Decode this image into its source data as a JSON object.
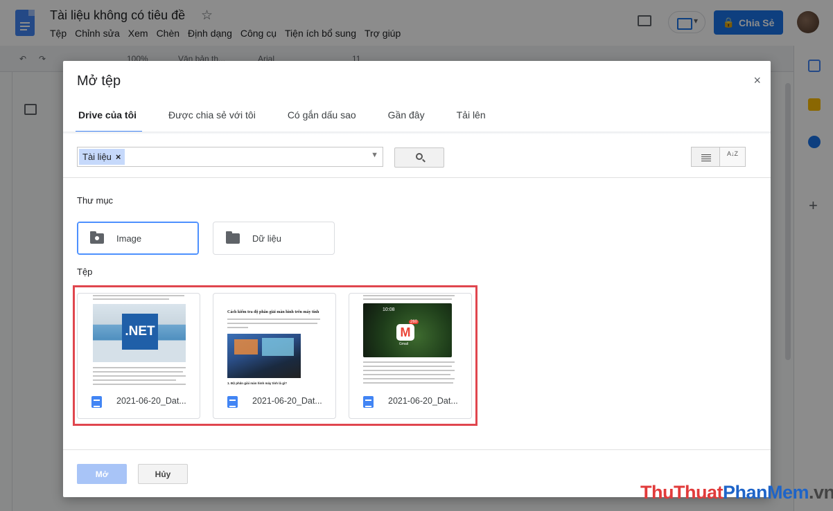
{
  "app": {
    "doc_title": "Tài liệu không có tiêu đề",
    "menu": [
      "Tệp",
      "Chỉnh sửa",
      "Xem",
      "Chèn",
      "Định dạng",
      "Công cụ",
      "Tiện ích bổ sung",
      "Trợ giúp"
    ],
    "share_label": "Chia Sẻ",
    "toolbar": {
      "zoom": "100%",
      "style": "Văn bản th...",
      "font": "Arial",
      "font_size": "11"
    }
  },
  "dialog": {
    "title": "Mở tệp",
    "close_glyph": "×",
    "tabs": [
      {
        "label": "Drive của tôi",
        "active": true
      },
      {
        "label": "Được chia sẻ với tôi",
        "active": false
      },
      {
        "label": "Có gắn dấu sao",
        "active": false
      },
      {
        "label": "Gần đây",
        "active": false
      },
      {
        "label": "Tải lên",
        "active": false
      }
    ],
    "search": {
      "chip_label": "Tài liệu",
      "chip_remove": "×",
      "sort_icon_text": "A↓Z"
    },
    "folders_heading": "Thư mục",
    "folders": [
      {
        "name": "Image",
        "icon": "shared-folder-icon",
        "selected": true
      },
      {
        "name": "Dữ liệu",
        "icon": "folder-icon",
        "selected": false
      }
    ],
    "files_heading": "Tệp",
    "files": [
      {
        "name": "2021-06-20_Dat...",
        "thumb_text": ".NET"
      },
      {
        "name": "2021-06-20_Dat...",
        "thumb_title": "Cách kiểm tra độ phân giải màn hình trên máy tính",
        "thumb_subhead": "1. Độ phân giải màn hình máy tính là gì?"
      },
      {
        "name": "2021-06-20_Dat...",
        "thumb_time": "10:08",
        "thumb_badge": "260",
        "thumb_app": "Gmail"
      }
    ],
    "buttons": {
      "open": "Mở",
      "cancel": "Hủy"
    }
  },
  "watermark": {
    "part1": "ThuThuat",
    "part2": "PhanMem",
    "part3": ".vn"
  },
  "colors": {
    "accent": "#4285f4",
    "share_button": "#1a73e8",
    "highlight_border": "#e0464e"
  }
}
